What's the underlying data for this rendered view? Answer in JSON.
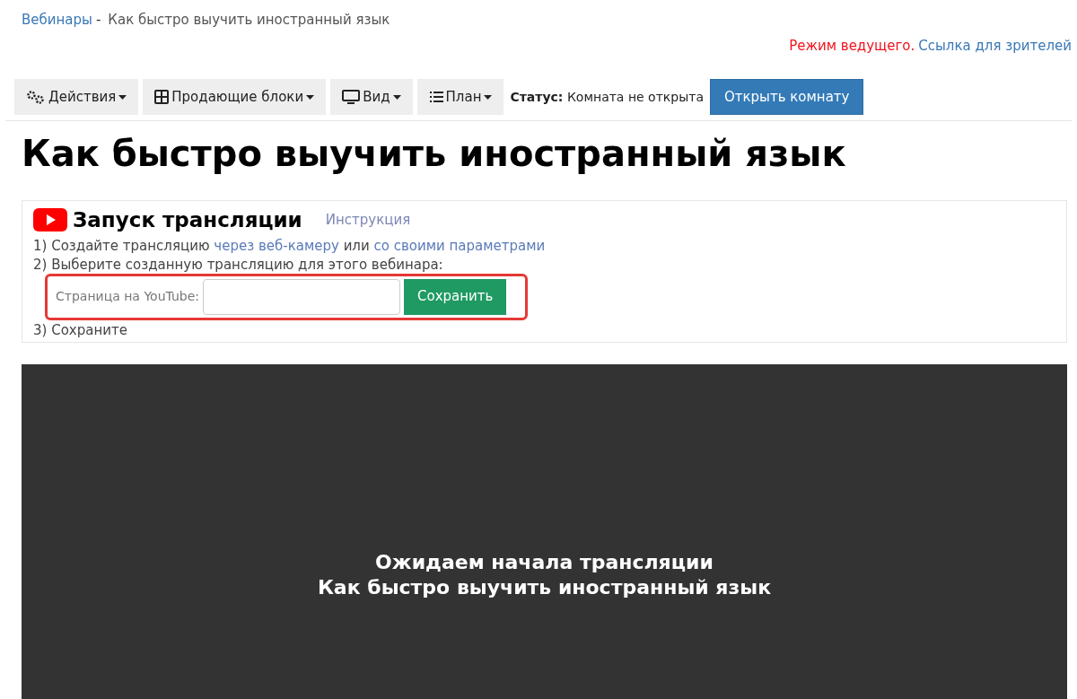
{
  "breadcrumb": {
    "link": "Вебинары",
    "separator": "-",
    "current": "Как быстро выучить иностранный язык"
  },
  "mode": {
    "label": "Режим ведущего.",
    "viewer_link": "Ссылка для зрителей"
  },
  "toolbar": {
    "menus": [
      {
        "label": "Действия",
        "kind": "gears"
      },
      {
        "label": "Продающие блоки",
        "kind": "grid"
      },
      {
        "label": "Вид",
        "kind": "monitor"
      },
      {
        "label": "План",
        "kind": "list"
      }
    ],
    "status_label": "Статус:",
    "status_value": "Комната не открыта",
    "open_button": "Открыть комнату"
  },
  "title": "Как быстро выучить иностранный язык",
  "stream": {
    "heading": "Запуск трансляции",
    "instruction_link": "Инструкция",
    "step1": [
      {
        "kind": "text",
        "text": "1) Создайте трансляцию"
      },
      {
        "kind": "link",
        "text": "через веб-камеру"
      },
      {
        "kind": "text",
        "text": "или"
      },
      {
        "kind": "link",
        "text": "со своими параметрами"
      }
    ],
    "step2": "2) Выберите созданную трансляцию для этого вебинара:",
    "field_label": "Страница на YouTube:",
    "save_button": "Сохранить",
    "highlighted": true,
    "step3": "3) Сохраните"
  },
  "player": {
    "line1": "Ожидаем начала трансляции",
    "line2": "Как быстро выучить иностранный язык"
  }
}
